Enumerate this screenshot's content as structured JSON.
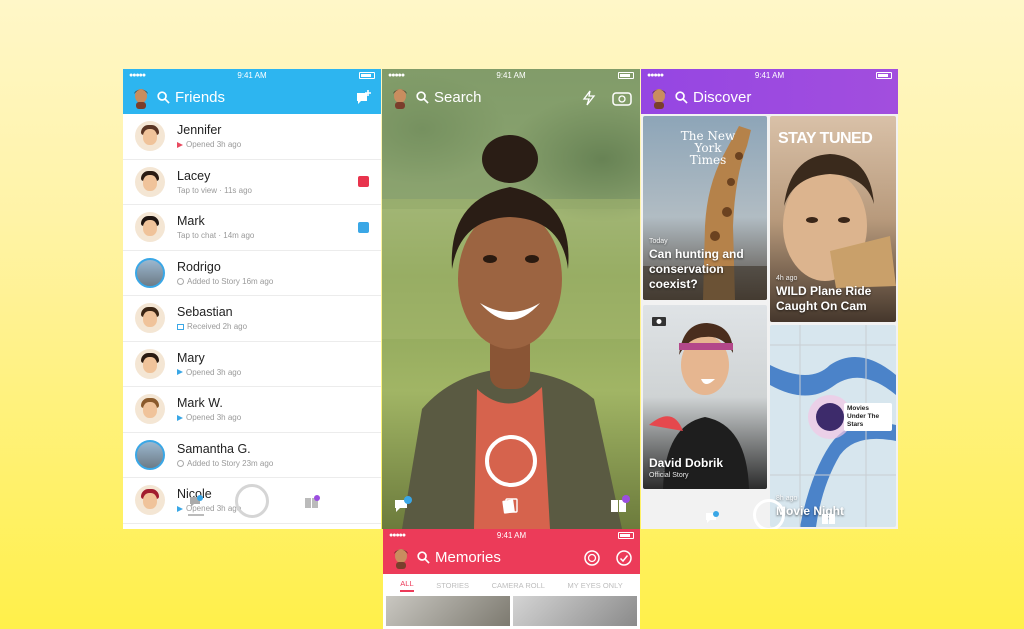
{
  "status": {
    "time": "9:41 AM"
  },
  "friends": {
    "title": "Friends",
    "items": [
      {
        "name": "Jennifer",
        "status": "Opened 3h ago",
        "hair": "#5a3524",
        "icon": "tri-red"
      },
      {
        "name": "Lacey",
        "status": "Tap to view · 11s ago",
        "hair": "#2a1b12",
        "icon": "none",
        "badge": "#e8344d"
      },
      {
        "name": "Mark",
        "status": "Tap to chat · 14m ago",
        "hair": "#1e1410",
        "icon": "none",
        "badge": "#3aa7e6"
      },
      {
        "name": "Rodrigo",
        "status": "Added to Story 16m ago",
        "hair": "#6b5546",
        "icon": "story"
      },
      {
        "name": "Sebastian",
        "status": "Received 2h ago",
        "hair": "#3b2615",
        "icon": "sq-blue"
      },
      {
        "name": "Mary",
        "status": "Opened 3h ago",
        "hair": "#2a1b12",
        "icon": "tri-blue"
      },
      {
        "name": "Mark W.",
        "status": "Opened 3h ago",
        "hair": "#8a5a2c",
        "icon": "tri-blue"
      },
      {
        "name": "Samantha G.",
        "status": "Added to Story 23m ago",
        "hair": "#6e6a65",
        "icon": "story"
      },
      {
        "name": "Nicole",
        "status": "Opened 3h ago",
        "hair": "#a11d2f",
        "icon": "tri-blue"
      }
    ]
  },
  "camera": {
    "search_label": "Search"
  },
  "memories": {
    "title": "Memories",
    "tabs": [
      "ALL",
      "STORIES",
      "CAMERA ROLL",
      "MY EYES ONLY"
    ]
  },
  "discover": {
    "title": "Discover",
    "tiles": [
      {
        "id": "nyt",
        "logo": "The New York Times",
        "kicker": "Today",
        "title": "Can hunting and conservation coexist?"
      },
      {
        "id": "staytuned",
        "logo": "STAY TUNED",
        "kicker": "4h ago",
        "title": "WILD Plane Ride Caught On Cam"
      },
      {
        "id": "dobrik",
        "kicker": "",
        "title": "David Dobrik",
        "sub": "Official Story"
      },
      {
        "id": "map",
        "map_label": "Movies Under The Stars",
        "kicker": "8h ago",
        "title": "Movie Night"
      }
    ]
  }
}
